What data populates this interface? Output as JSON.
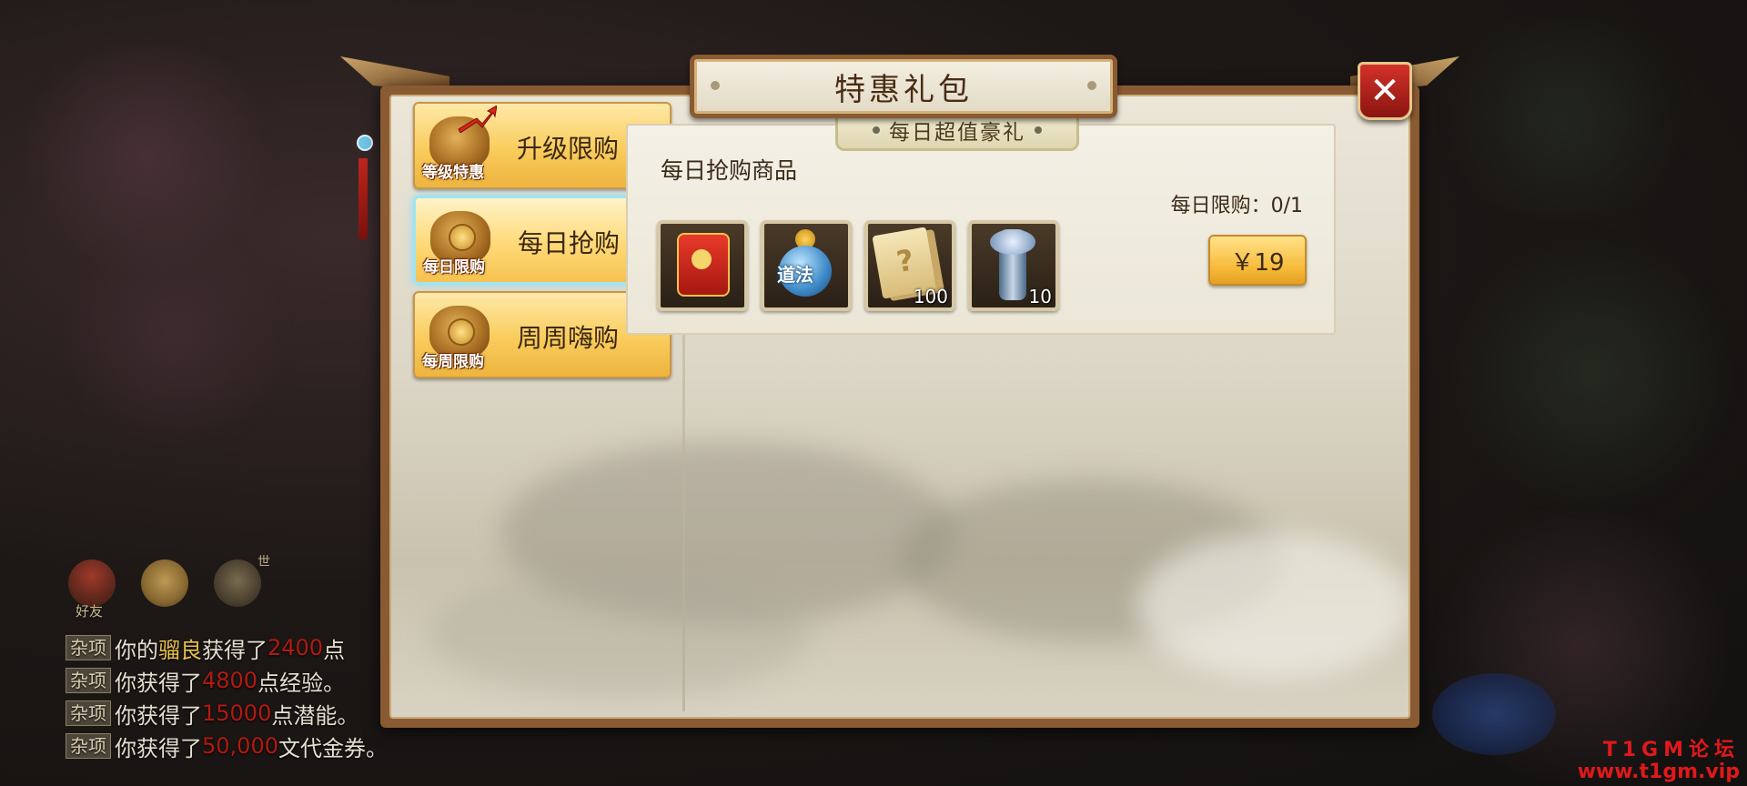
{
  "panel": {
    "title": "特惠礼包",
    "close_label": "✕"
  },
  "tabs": [
    {
      "label": "升级限购",
      "icon_label": "等级特惠",
      "icon": "money-bag-arrow-icon"
    },
    {
      "label": "每日抢购",
      "icon_label": "每日限购",
      "icon": "money-bag-icon",
      "active": true
    },
    {
      "label": "周周嗨购",
      "icon_label": "每周限购",
      "icon": "money-bag-icon"
    }
  ],
  "card": {
    "tag": "每日超值豪礼",
    "title": "每日抢购商品",
    "limit": "每日限购：0/1",
    "price": "￥19",
    "items": [
      {
        "name": "red-envelope-icon",
        "count": ""
      },
      {
        "name": "gourd-icon",
        "label": "道法",
        "count": ""
      },
      {
        "name": "card-pack-icon",
        "count": "100"
      },
      {
        "name": "staff-icon",
        "count": "10"
      }
    ]
  },
  "hud": {
    "friend_label": "好友",
    "world_label": "世"
  },
  "chat": [
    {
      "tag": "杂项",
      "pre": "你的",
      "name": "骝良",
      "mid": "获得了",
      "value": "2400",
      "post": "点"
    },
    {
      "tag": "杂项",
      "pre": "你获得了",
      "value": "4800",
      "post": "点经验。"
    },
    {
      "tag": "杂项",
      "pre": "你获得了",
      "value": "15000",
      "post": "点潜能。"
    },
    {
      "tag": "杂项",
      "pre": "你获得了",
      "value": "50,000",
      "post": "文代金券。"
    }
  ],
  "watermark": {
    "line1": "T1GM论坛",
    "line2": "www.t1gm.vip"
  }
}
